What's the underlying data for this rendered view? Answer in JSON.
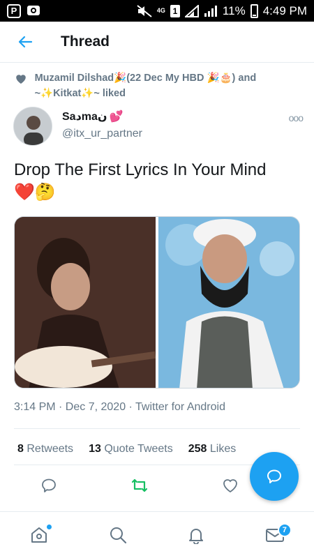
{
  "status_bar": {
    "network": "4G",
    "sim": "1",
    "battery": "11%",
    "time": "4:49 PM"
  },
  "header": {
    "title": "Thread"
  },
  "social_context": {
    "text": "Muzamil Dilshad🎉(22 Dec My HBD 🎉🎂) and ~✨Kitkat✨~ liked"
  },
  "author": {
    "display_name": "Saدmaن",
    "display_name_emoji": "💕",
    "handle": "@itx_ur_partner",
    "more_icon": "ooo"
  },
  "tweet": {
    "text": "Drop The First Lyrics In Your Mind",
    "emojis": "❤️🤔",
    "meta": "3:14 PM · Dec 7, 2020 · Twitter for Android"
  },
  "stats": {
    "retweets_count": "8",
    "retweets_label": "Retweets",
    "quotes_count": "13",
    "quotes_label": "Quote Tweets",
    "likes_count": "258",
    "likes_label": "Likes"
  },
  "bottom_nav": {
    "messages_badge": "7"
  },
  "colors": {
    "accent": "#1da1f2",
    "retweet": "#17bf63",
    "secondary_text": "#657786"
  }
}
